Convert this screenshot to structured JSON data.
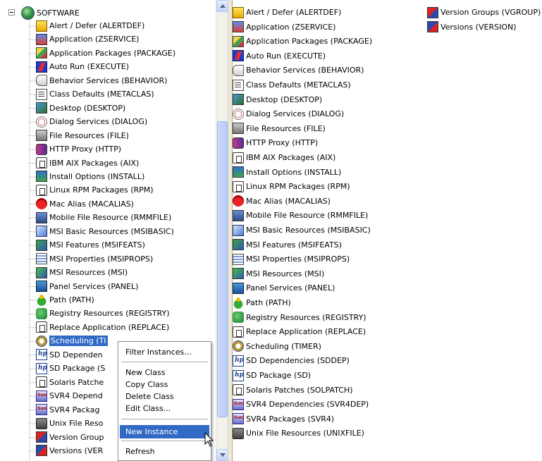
{
  "tree": {
    "root_label": "SOFTWARE",
    "root_icon": "globe-icon",
    "items": [
      {
        "label": "Alert / Defer (ALERTDEF)",
        "icon": "alert"
      },
      {
        "label": "Application (ZSERVICE)",
        "icon": "app"
      },
      {
        "label": "Application Packages (PACKAGE)",
        "icon": "pkg"
      },
      {
        "label": "Auto Run (EXECUTE)",
        "icon": "run"
      },
      {
        "label": "Behavior Services (BEHAVIOR)",
        "icon": "hand"
      },
      {
        "label": "Class Defaults (METACLAS)",
        "icon": "doc"
      },
      {
        "label": "Desktop (DESKTOP)",
        "icon": "desk"
      },
      {
        "label": "Dialog Services (DIALOG)",
        "icon": "dialog"
      },
      {
        "label": "File Resources (FILE)",
        "icon": "file"
      },
      {
        "label": "HTTP Proxy (HTTP)",
        "icon": "http"
      },
      {
        "label": "IBM AIX Packages (AIX)",
        "icon": "outline"
      },
      {
        "label": "Install Options (INSTALL)",
        "icon": "install"
      },
      {
        "label": "Linux RPM Packages (RPM)",
        "icon": "outline"
      },
      {
        "label": "Mac Alias (MACALIAS)",
        "icon": "mac"
      },
      {
        "label": "Mobile File Resource (RMMFILE)",
        "icon": "mobile"
      },
      {
        "label": "MSI Basic Resources (MSIBASIC)",
        "icon": "msi"
      },
      {
        "label": "MSI Features (MSIFEATS)",
        "icon": "msifeat"
      },
      {
        "label": "MSI Properties (MSIPROPS)",
        "icon": "props"
      },
      {
        "label": "MSI Resources (MSI)",
        "icon": "msires"
      },
      {
        "label": "Panel Services (PANEL)",
        "icon": "panel"
      },
      {
        "label": "Path (PATH)",
        "icon": "path"
      },
      {
        "label": "Registry Resources (REGISTRY)",
        "icon": "reg"
      },
      {
        "label": "Replace Application (REPLACE)",
        "icon": "outline"
      },
      {
        "label": "Scheduling (TIMER)",
        "icon": "timer"
      },
      {
        "label": "SD Dependen",
        "icon": "hp"
      },
      {
        "label": "SD Package (S",
        "icon": "hp"
      },
      {
        "label": "Solaris Patche",
        "icon": "outline"
      },
      {
        "label": "SVR4 Depend",
        "icon": "sun"
      },
      {
        "label": "SVR4 Packag",
        "icon": "sun"
      },
      {
        "label": "Unix File Reso",
        "icon": "unix"
      },
      {
        "label": "Version Group",
        "icon": "vgroup"
      },
      {
        "label": "Versions (VER",
        "icon": "version"
      }
    ],
    "selected_label": "Scheduling (TI"
  },
  "list": {
    "items": [
      {
        "label": "Alert / Defer (ALERTDEF)",
        "icon": "alert"
      },
      {
        "label": "Application (ZSERVICE)",
        "icon": "app"
      },
      {
        "label": "Application Packages (PACKAGE)",
        "icon": "pkg"
      },
      {
        "label": "Auto Run (EXECUTE)",
        "icon": "run"
      },
      {
        "label": "Behavior Services (BEHAVIOR)",
        "icon": "hand"
      },
      {
        "label": "Class Defaults (METACLAS)",
        "icon": "doc"
      },
      {
        "label": "Desktop (DESKTOP)",
        "icon": "desk"
      },
      {
        "label": "Dialog Services (DIALOG)",
        "icon": "dialog"
      },
      {
        "label": "File Resources (FILE)",
        "icon": "file"
      },
      {
        "label": "HTTP Proxy (HTTP)",
        "icon": "http"
      },
      {
        "label": "IBM AIX Packages (AIX)",
        "icon": "outline"
      },
      {
        "label": "Install Options (INSTALL)",
        "icon": "install"
      },
      {
        "label": "Linux RPM Packages (RPM)",
        "icon": "outline"
      },
      {
        "label": "Mac Alias (MACALIAS)",
        "icon": "mac"
      },
      {
        "label": "Mobile File Resource (RMMFILE)",
        "icon": "mobile"
      },
      {
        "label": "MSI Basic Resources (MSIBASIC)",
        "icon": "msi"
      },
      {
        "label": "MSI Features (MSIFEATS)",
        "icon": "msifeat"
      },
      {
        "label": "MSI Properties (MSIPROPS)",
        "icon": "props"
      },
      {
        "label": "MSI Resources (MSI)",
        "icon": "msires"
      },
      {
        "label": "Panel Services (PANEL)",
        "icon": "panel"
      },
      {
        "label": "Path (PATH)",
        "icon": "path"
      },
      {
        "label": "Registry Resources (REGISTRY)",
        "icon": "reg"
      },
      {
        "label": "Replace Application (REPLACE)",
        "icon": "outline"
      },
      {
        "label": "Scheduling (TIMER)",
        "icon": "timer"
      },
      {
        "label": "SD Dependencies (SDDEP)",
        "icon": "hp"
      },
      {
        "label": "SD Package (SD)",
        "icon": "hp"
      },
      {
        "label": "Solaris Patches (SOLPATCH)",
        "icon": "outline"
      },
      {
        "label": "SVR4 Dependencies (SVR4DEP)",
        "icon": "sun"
      },
      {
        "label": "SVR4 Packages (SVR4)",
        "icon": "sun"
      },
      {
        "label": "Unix File Resources (UNIXFILE)",
        "icon": "unix"
      },
      {
        "label": "Version Groups (VGROUP)",
        "icon": "vgroup"
      },
      {
        "label": "Versions (VERSION)",
        "icon": "version"
      }
    ]
  },
  "context_menu": {
    "filter_instances": "Filter Instances...",
    "new_class": "New Class",
    "copy_class": "Copy Class",
    "delete_class": "Delete Class",
    "edit_class": "Edit Class...",
    "new_instance": "New Instance",
    "refresh": "Refresh"
  },
  "colors": {
    "selection": "#316ac5",
    "scrollbar": "#c1d3fb"
  }
}
